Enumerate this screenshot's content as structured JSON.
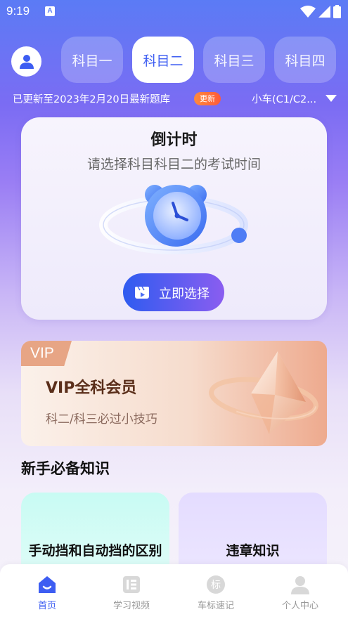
{
  "status_bar": {
    "time": "9:19",
    "app_badge": "A"
  },
  "header": {
    "tabs": [
      {
        "label": "科目一",
        "active": false
      },
      {
        "label": "科目二",
        "active": true
      },
      {
        "label": "科目三",
        "active": false
      },
      {
        "label": "科目四",
        "active": false
      }
    ],
    "update_text": "已更新至2023年2月20日最新题库",
    "update_badge": "更新",
    "car_type": "小车(C1/C2..."
  },
  "countdown": {
    "title": "倒计时",
    "subtitle": "请选择科目科目二的考试时间",
    "button_label": "立即选择"
  },
  "vip": {
    "tag": "VIP",
    "title": "VIP全科会员",
    "subtitle": "科二/科三必过小技巧"
  },
  "knowledge": {
    "section_title": "新手必备知识",
    "cards": [
      {
        "label": "手动挡和自动挡的区别"
      },
      {
        "label": "违章知识"
      }
    ]
  },
  "bottom_nav": {
    "items": [
      {
        "label": "首页",
        "icon": "home-icon",
        "active": true
      },
      {
        "label": "学习视频",
        "icon": "video-icon",
        "active": false
      },
      {
        "label": "车标速记",
        "icon": "car-logo-icon",
        "active": false
      },
      {
        "label": "个人中心",
        "icon": "person-icon",
        "active": false
      }
    ]
  },
  "colors": {
    "accent": "#3d5df2",
    "vip_brown": "#5a2e1a",
    "badge_orange": "#ff6a3a"
  }
}
